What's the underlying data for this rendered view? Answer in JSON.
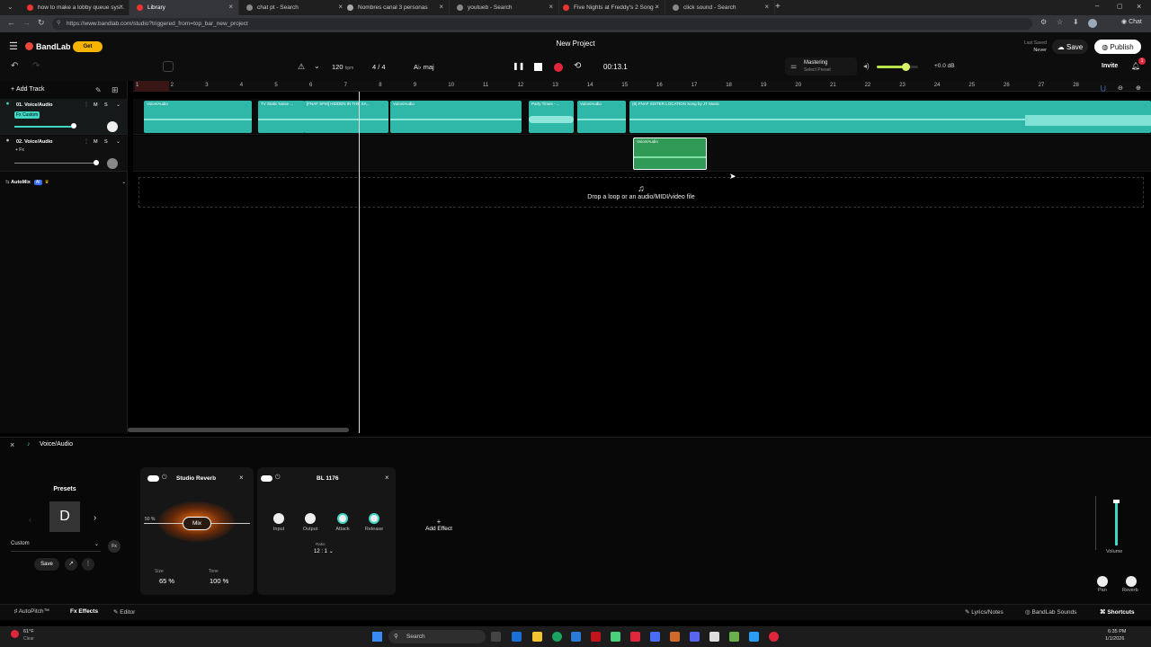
{
  "browser": {
    "tabs": [
      {
        "title": "how to make a lobby queue sys...",
        "color": "#e33"
      },
      {
        "title": "Library",
        "color": "#e33"
      },
      {
        "title": "chat pt - Search",
        "color": "#888"
      },
      {
        "title": "Nombres canal 3 personas",
        "color": "#aaa"
      },
      {
        "title": "youtueb - Search",
        "color": "#888"
      },
      {
        "title": "Five Nights at Freddy's 2 Song -",
        "color": "#e33"
      },
      {
        "title": "click sound - Search",
        "color": "#888"
      }
    ],
    "url": "https://www.bandlab.com/studio?triggered_from=top_bar_new_project",
    "chat_label": "Chat"
  },
  "app": {
    "logo": "BandLab",
    "get_badge": "Get",
    "project_title": "New Project",
    "last_saved_label": "Last Saved",
    "last_saved_value": "Never",
    "save_label": "Save",
    "publish_label": "Publish",
    "invite_label": "Invite",
    "notification_count": "1",
    "bpm": "120",
    "bpm_unit": "bpm",
    "time_signature": "4 / 4",
    "key": "A♭ maj",
    "time": "00:13.1",
    "mastering_label": "Mastering",
    "mastering_preset": "Select Preset",
    "master_volume": "+0.0 dB",
    "master_volume_level": 0.7,
    "add_track_label": "Add Track"
  },
  "ruler": [
    "1",
    "2",
    "3",
    "4",
    "5",
    "6",
    "7",
    "8",
    "9",
    "10",
    "11",
    "12",
    "13",
    "14",
    "15",
    "16",
    "17",
    "18",
    "19",
    "20",
    "21",
    "22",
    "23",
    "24",
    "25",
    "26",
    "27",
    "28"
  ],
  "tracks": [
    {
      "name": "01. Voice/Audio",
      "tag": "Fx Custom",
      "m": "M",
      "s": "S",
      "clips": [
        "Voice/Audio",
        "TV Static Noise ...",
        "[FNAF SFM] HIDDEN IN THE SA...",
        "Voice/Audio",
        "Party Times - ...",
        "Voice/Audio",
        "(8) FNAF SISTER LOCATION Song by JT Music"
      ]
    },
    {
      "name": "02. Voice/Audio",
      "tag": "+ Fx",
      "m": "M",
      "s": "S",
      "clips": [
        "Voice/Audio"
      ]
    }
  ],
  "automix": {
    "label": "AutoMix",
    "badge": "AI"
  },
  "drop_text": "Drop a loop or an audio/MIDI/video file",
  "panel": {
    "track_name": "Voice/Audio",
    "presets_label": "Presets",
    "preset_letter": "D",
    "preset_name": "Custom",
    "save_label": "Save",
    "reverb": {
      "name": "Studio Reverb",
      "mix_label": "Mix",
      "mix_value": "50 %",
      "size_label": "Size",
      "size_value": "65 %",
      "tone_label": "Tone",
      "tone_value": "100 %"
    },
    "comp": {
      "name": "BL 1176",
      "knobs": [
        "Input",
        "Output",
        "Attack",
        "Release"
      ],
      "ratio_label": "Ratio",
      "ratio_value": "12 : 1"
    },
    "add_effect": "Add Effect",
    "volume_label": "Volume",
    "pan_label": "Pan",
    "reverb_label": "Reverb"
  },
  "status": {
    "autopitch": "AutoPitch™",
    "effects": "Effects",
    "editor": "Editor",
    "lyrics": "Lyrics/Notes",
    "sounds": "BandLab Sounds",
    "shortcuts": "Shortcuts"
  },
  "taskbar": {
    "weather_temp": "61°F",
    "weather_desc": "Clear",
    "search": "Search",
    "time": "6:35 PM",
    "date": "1/1/2026"
  }
}
